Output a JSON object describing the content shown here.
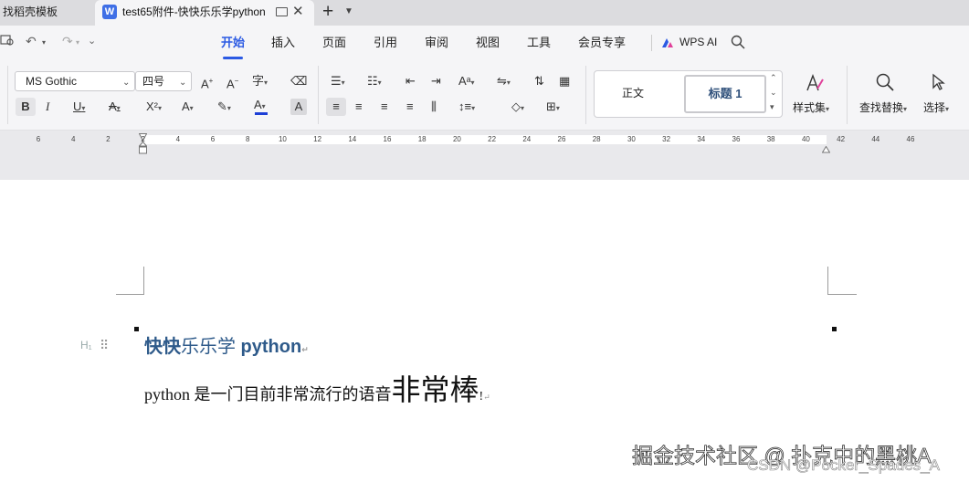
{
  "tabs": {
    "inactive_label": "找稻壳模板",
    "active_logo": "W",
    "active_title": "test65附件-快快乐乐学python",
    "close_glyph": "✕",
    "new_tab_glyph": "+",
    "more_glyph": "⌄"
  },
  "ribbon_tabs": [
    "开始",
    "插入",
    "页面",
    "引用",
    "审阅",
    "视图",
    "工具",
    "会员专享"
  ],
  "wps_ai": "WPS AI",
  "font": {
    "family": "MS Gothic",
    "size": "四号"
  },
  "styles": {
    "normal": "正文",
    "heading1": "标题 1",
    "style_set_label": "样式集"
  },
  "tools": {
    "find_replace_label": "查找替换",
    "select_label": "选择"
  },
  "ruler_ticks": [
    "6",
    "4",
    "2",
    "2",
    "4",
    "6",
    "8",
    "10",
    "12",
    "14",
    "16",
    "18",
    "20",
    "22",
    "24",
    "26",
    "28",
    "30",
    "32",
    "34",
    "36",
    "38",
    "40",
    "42",
    "44",
    "46"
  ],
  "document": {
    "heading_part1": "快快",
    "heading_part2": "乐乐学",
    "heading_part3": " python",
    "body_small": "python 是一门目前非常流行的语音",
    "body_big": "非常棒",
    "body_end": "!",
    "paragraph_mark": "↵"
  },
  "watermarks": {
    "line1": "掘金技术社区 @ 扑克中的黑桃A",
    "line2": "CSDN @Pocker_Spades_A"
  },
  "colors": {
    "accent": "#2b5ae3",
    "heading": "#2e5a8a",
    "font_color_bar": "#1d3fd6"
  }
}
